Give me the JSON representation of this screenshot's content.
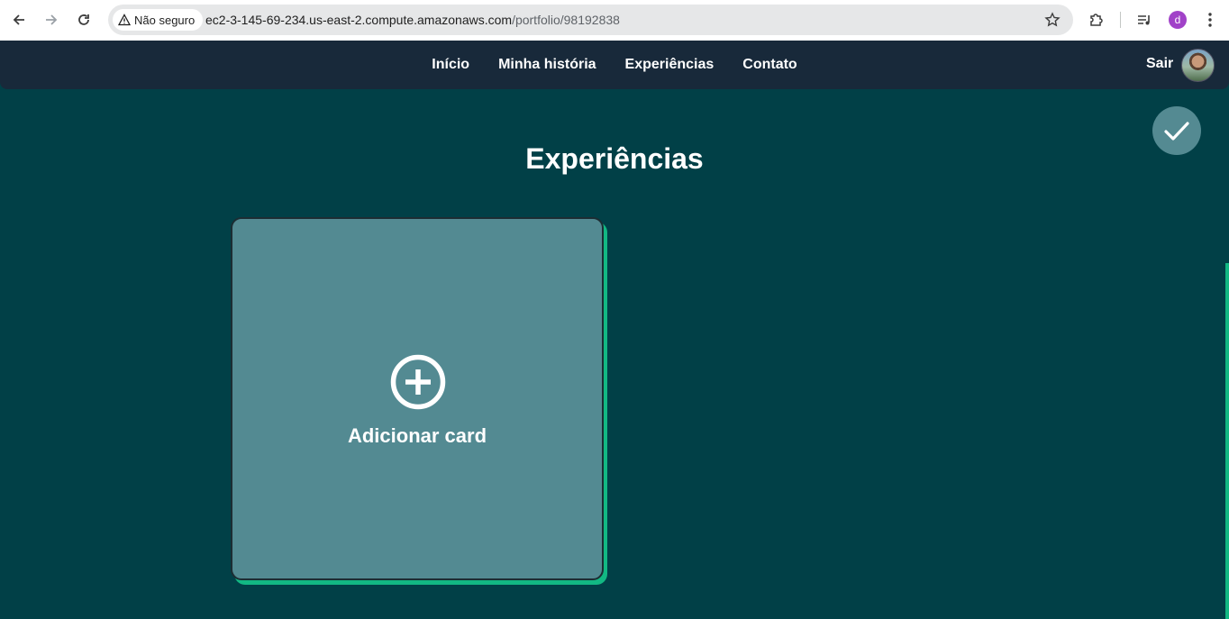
{
  "browser": {
    "security_label": "Não seguro",
    "url_host": "ec2-3-145-69-234.us-east-2.compute.amazonaws.com",
    "url_path": "/portfolio/98192838",
    "profile_initial": "d",
    "colors": {
      "profile": "#a142c8"
    }
  },
  "header": {
    "menu": [
      "Início",
      "Minha história",
      "Experiências",
      "Contato"
    ],
    "logout_label": "Sair",
    "colors": {
      "background": "#18293a"
    }
  },
  "page": {
    "title": "Experiências",
    "add_card_label": "Adicionar card",
    "icons": {
      "add": "plus-circle-icon",
      "save": "checkmark-icon"
    },
    "colors": {
      "background": "#014047",
      "card": "#538a92",
      "accent": "#12b883"
    }
  }
}
